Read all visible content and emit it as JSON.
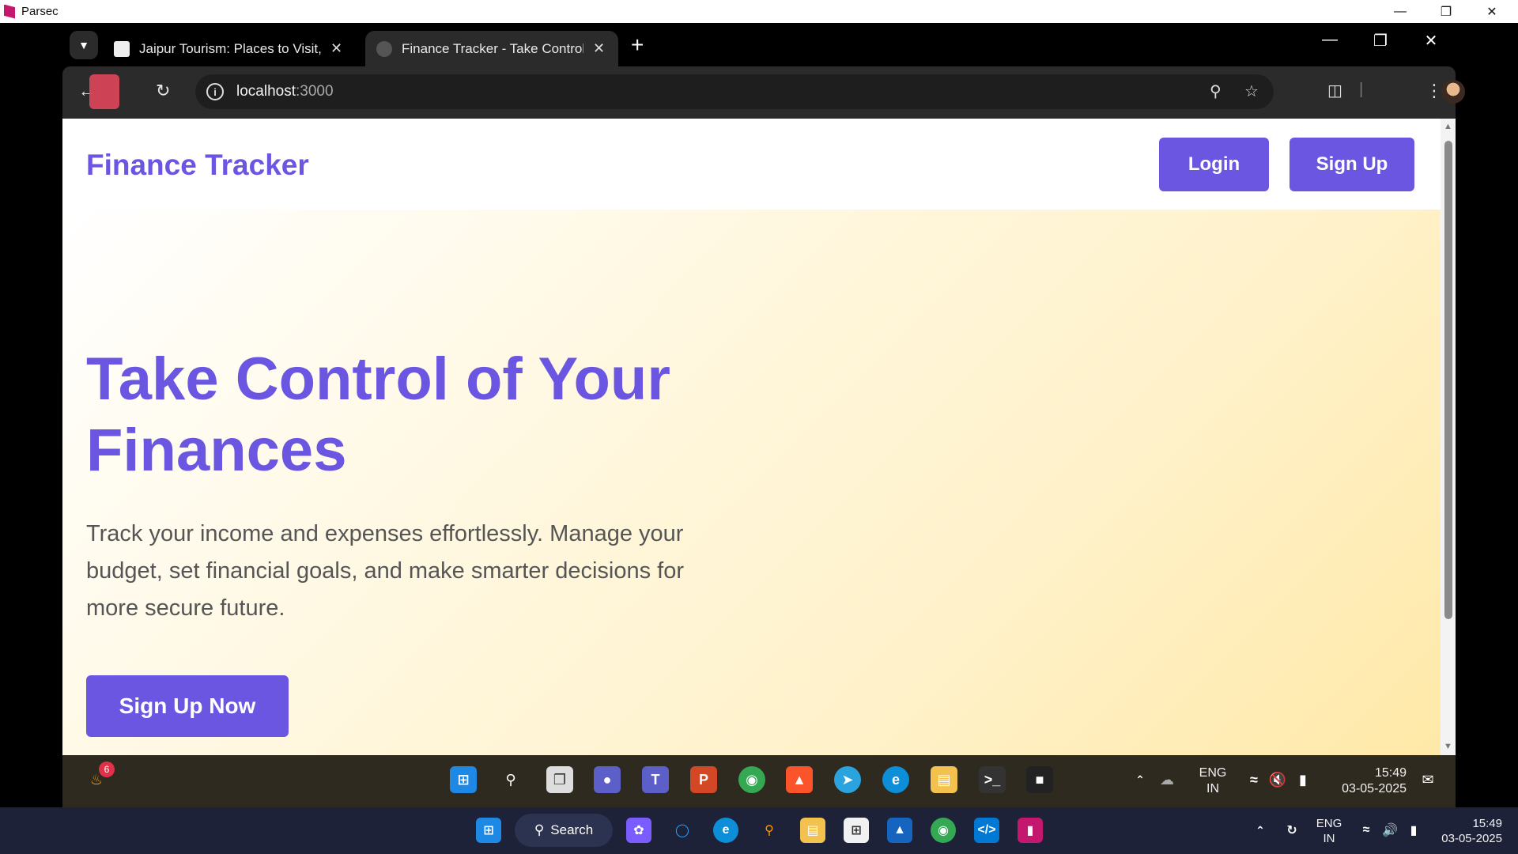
{
  "parsec": {
    "title": "Parsec"
  },
  "tabs": [
    {
      "title": "Jaipur Tourism: Places to Visit, S",
      "active": false
    },
    {
      "title": "Finance Tracker - Take Control c",
      "active": true
    }
  ],
  "address": {
    "host": "localhost",
    "port": ":3000"
  },
  "site": {
    "brand": "Finance Tracker",
    "login_label": "Login",
    "signup_label": "Sign Up",
    "hero_title": "Take Control of Your Finances",
    "hero_text": "Track your income and expenses effortlessly. Manage your budget, set financial goals, and make smarter decisions for more secure future.",
    "cta_label": "Sign Up Now"
  },
  "remote_taskbar": {
    "notification_count": "6",
    "lang_top": "ENG",
    "lang_bottom": "IN",
    "time": "15:49",
    "date": "03-05-2025"
  },
  "local_taskbar": {
    "search_label": "Search",
    "lang_top": "ENG",
    "lang_bottom": "IN",
    "time": "15:49",
    "date": "03-05-2025"
  },
  "colors": {
    "accent": "#6a56e0",
    "hero_warm": "#ffe9a8"
  }
}
